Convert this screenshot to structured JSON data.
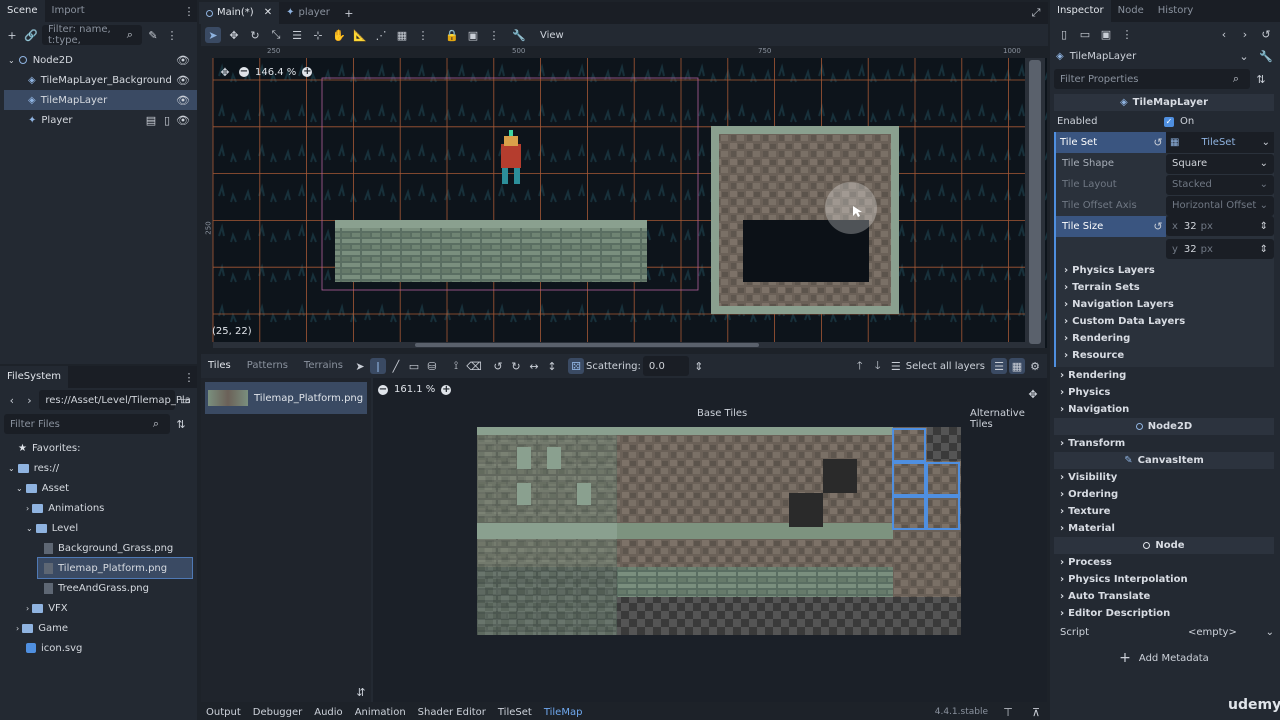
{
  "scene_dock": {
    "tabs": [
      "Scene",
      "Import"
    ],
    "filter_placeholder": "Filter: name, t:type,",
    "nodes": [
      {
        "label": "Node2D"
      },
      {
        "label": "TileMapLayer_Background"
      },
      {
        "label": "TileMapLayer"
      },
      {
        "label": "Player"
      }
    ]
  },
  "filesystem": {
    "tab": "FileSystem",
    "path": "res://Asset/Level/Tilemap_Pla",
    "filter_placeholder": "Filter Files",
    "items": [
      {
        "label": "Favorites:"
      },
      {
        "label": "res://"
      },
      {
        "label": "Asset"
      },
      {
        "label": "Animations"
      },
      {
        "label": "Level"
      },
      {
        "label": "Background_Grass.png"
      },
      {
        "label": "Tilemap_Platform.png"
      },
      {
        "label": "TreeAndGrass.png"
      },
      {
        "label": "VFX"
      },
      {
        "label": "Game"
      },
      {
        "label": "icon.svg"
      }
    ]
  },
  "editor_tabs": [
    {
      "label": "Main(*)"
    },
    {
      "label": "player"
    }
  ],
  "toolbar": {
    "view": "View"
  },
  "viewport": {
    "zoom": "146.4 %",
    "coords": "(25, 22)",
    "ruler": [
      "250",
      "500",
      "750",
      "1000"
    ],
    "ruler_side": "250"
  },
  "tileset_panel": {
    "tabs": [
      "Tiles",
      "Patterns",
      "Terrains"
    ],
    "scattering_label": "Scattering:",
    "scattering_value": "0.0",
    "select_all_layers": "Select all layers",
    "tile_source": "Tilemap_Platform.png",
    "zoom": "161.1 %",
    "base_tiles": "Base Tiles",
    "alternative_tiles": "Alternative Tiles"
  },
  "bottom_bar": {
    "tabs": [
      "Output",
      "Debugger",
      "Audio",
      "Animation",
      "Shader Editor",
      "TileSet",
      "TileMap"
    ],
    "version": "4.4.1.stable"
  },
  "inspector": {
    "tabs": [
      "Inspector",
      "Node",
      "History"
    ],
    "object": "TileMapLayer",
    "filter_placeholder": "Filter Properties",
    "class_header": "TileMapLayer",
    "enabled_label": "Enabled",
    "enabled_value": "On",
    "tile_set_label": "Tile Set",
    "tile_set_value": "TileSet",
    "tile_shape_label": "Tile Shape",
    "tile_shape_value": "Square",
    "tile_layout_label": "Tile Layout",
    "tile_layout_value": "Stacked",
    "tile_offset_label": "Tile Offset Axis",
    "tile_offset_value": "Horizontal Offset",
    "tile_size_label": "Tile Size",
    "tile_size_x": "32",
    "tile_size_y": "32",
    "unit": "px",
    "sub_sections": [
      "Physics Layers",
      "Terrain Sets",
      "Navigation Layers",
      "Custom Data Layers",
      "Rendering",
      "Resource"
    ],
    "layer_sections": [
      "Rendering",
      "Physics",
      "Navigation"
    ],
    "node2d_header": "Node2D",
    "node2d_sections": [
      "Transform"
    ],
    "canvasitem_header": "CanvasItem",
    "canvasitem_sections": [
      "Visibility",
      "Ordering",
      "Texture",
      "Material"
    ],
    "node_header": "Node",
    "node_sections": [
      "Process",
      "Physics Interpolation",
      "Auto Translate",
      "Editor Description"
    ],
    "script_label": "Script",
    "script_value": "<empty>",
    "add_metadata": "Add Metadata"
  },
  "watermark": "udemy",
  "colors": {
    "accent": "#4f8fe0",
    "grid": "#c0653a",
    "selection": "#3a4a63"
  }
}
